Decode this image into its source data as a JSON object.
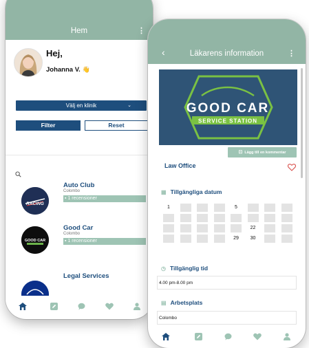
{
  "left_screen": {
    "header": {
      "title": "Hem"
    },
    "greeting": {
      "hello": "Hej,",
      "user_name": "Johanna V."
    },
    "clinic_select": {
      "label": "Välj en klinik"
    },
    "buttons": {
      "filter": "Filter",
      "reset": "Reset"
    },
    "clinics": [
      {
        "name": "Auto Club",
        "city": "Colombo",
        "reviews": "1 recensioner",
        "logo_text": "RACING"
      },
      {
        "name": "Good Car",
        "city": "Colombo",
        "reviews": "1 recensioner",
        "logo_text": "GOOD CAR"
      },
      {
        "name": "Legal Services",
        "city": "",
        "reviews": "",
        "logo_text": ""
      }
    ],
    "nav_icons": [
      "home-icon",
      "edit-icon",
      "chat-icon",
      "heart-icon",
      "user-icon"
    ]
  },
  "right_screen": {
    "header": {
      "title": "Läkarens information"
    },
    "banner": {
      "line1": "GOOD CAR",
      "line2": "SERVICE STATION"
    },
    "comment_button": "Lägg till en kommentar",
    "office_name": "Law Office",
    "available_dates": {
      "heading": "Tillgängliga datum",
      "rows": [
        [
          "1",
          "",
          "",
          "",
          "5",
          "",
          "",
          ""
        ],
        [
          "",
          "",
          "",
          "",
          "",
          "",
          "",
          ""
        ],
        [
          "",
          "",
          "",
          "",
          "",
          "22",
          "",
          ""
        ],
        [
          "",
          "",
          "",
          "",
          "29",
          "30",
          "",
          ""
        ]
      ]
    },
    "available_time": {
      "heading": "Tillgänglig tid",
      "value": "4.00 pm-8.00 pm"
    },
    "workplace": {
      "heading": "Arbetsplats",
      "value": "Colombo"
    },
    "nav_icons": [
      "home-icon",
      "edit-icon",
      "chat-icon",
      "heart-icon",
      "user-icon"
    ]
  },
  "colors": {
    "header_green": "#92b5a5",
    "navy": "#1e4e7d",
    "badge_green": "#9ec4b4",
    "heart_red": "#d9534f"
  }
}
